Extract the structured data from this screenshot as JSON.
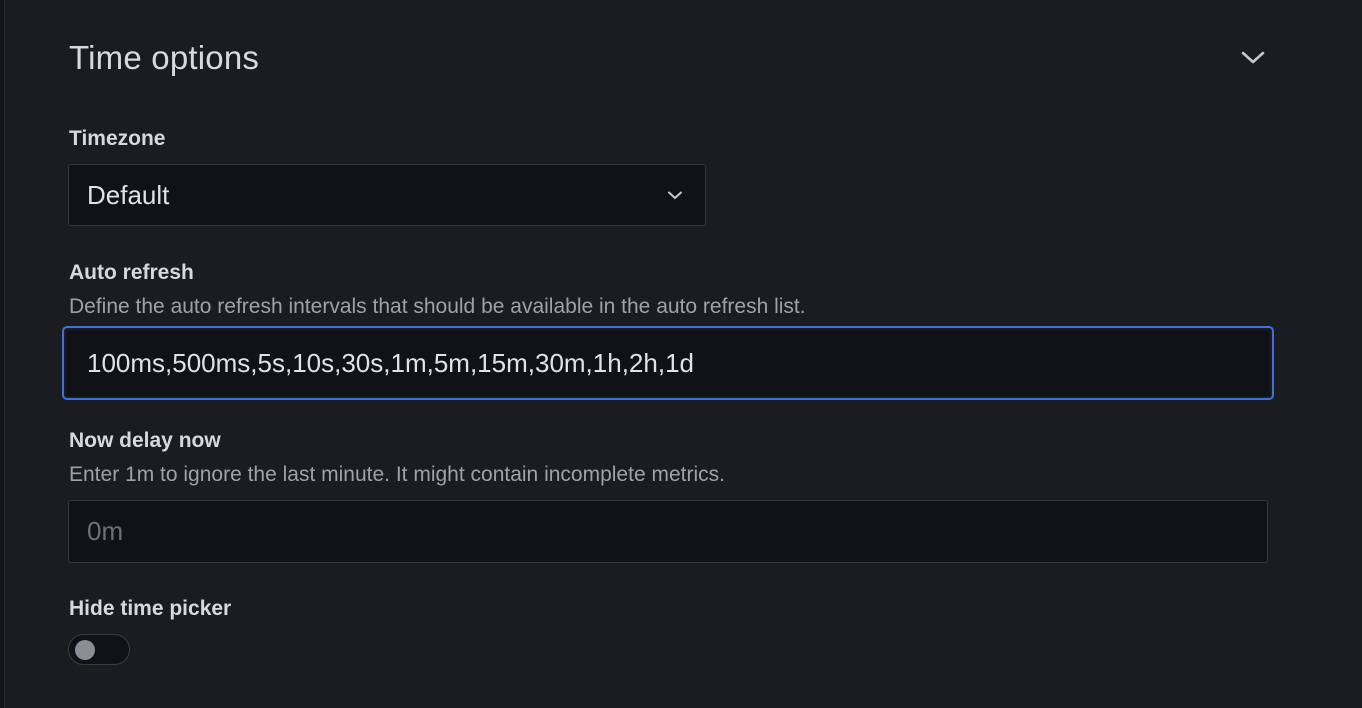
{
  "section": {
    "title": "Time options",
    "collapse_icon": "chevron-down-icon"
  },
  "timezone": {
    "label": "Timezone",
    "value": "Default",
    "dropdown_icon": "chevron-down-icon"
  },
  "auto_refresh": {
    "label": "Auto refresh",
    "description": "Define the auto refresh intervals that should be available in the auto refresh list.",
    "value": "100ms,500ms,5s,10s,30s,1m,5m,15m,30m,1h,2h,1d",
    "focused": true
  },
  "now_delay": {
    "label": "Now delay now",
    "description": "Enter 1m to ignore the last minute. It might contain incomplete metrics.",
    "value": "",
    "placeholder": "0m"
  },
  "hide_time_picker": {
    "label": "Hide time picker",
    "checked": false
  },
  "colors": {
    "background": "#1b1c20",
    "input_background": "#111217",
    "focus_ring": "#3d71d9",
    "text_primary": "#d8d9dc",
    "text_secondary": "#9fa1a8"
  }
}
